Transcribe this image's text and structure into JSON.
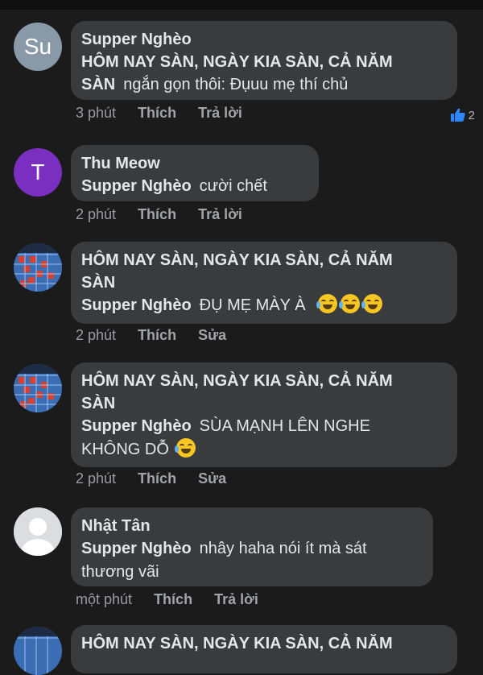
{
  "comments": [
    {
      "avatar_initials": "Su",
      "author": "Supper Nghèo",
      "text_line1": "HÔM NAY SÀN, NGÀY KIA SÀN, CẢ NĂM",
      "text_line2_bold": "SÀN",
      "text_line2_rest": "ngắn gọn thôi: Đụuu mẹ thí chủ",
      "time": "3 phút",
      "like": "Thích",
      "reply": "Trả lời",
      "reaction_count": "2"
    },
    {
      "avatar_initials": "T",
      "author": "Thu Meow",
      "mention": "Supper Nghèo",
      "text": "cười chết",
      "time": "2 phút",
      "like": "Thích",
      "reply": "Trả lời"
    },
    {
      "author_line1": "HÔM NAY SÀN, NGÀY KIA SÀN, CẢ NĂM",
      "author_line2": "SÀN",
      "mention": "Supper Nghèo",
      "text": "ĐỤ MẸ MÀY À",
      "time": "2 phút",
      "like": "Thích",
      "edit": "Sửa"
    },
    {
      "author_line1": "HÔM NAY SÀN, NGÀY KIA SÀN, CẢ NĂM",
      "author_line2": "SÀN",
      "mention": "Supper Nghèo",
      "text_line1": "SÙA MẠNH LÊN NGHE",
      "text_line2": "KHÔNG DỖ",
      "time": "2 phút",
      "like": "Thích",
      "edit": "Sửa"
    },
    {
      "author": "Nhật Tân",
      "mention": "Supper Nghèo",
      "text_line1": "nhây haha nói ít mà sát",
      "text_line2": "thương vãi",
      "time": "một phút",
      "like": "Thích",
      "reply": "Trả lời"
    },
    {
      "author_line1": "HÔM NAY SÀN, NGÀY KIA SÀN, CẢ NĂM"
    }
  ],
  "icons": {
    "like_reaction": "thumbs-up-icon",
    "laughing": "laughing-emoji-icon"
  },
  "colors": {
    "background": "#1b1b1c",
    "bubble": "#3a3b3c",
    "like_blue": "#2d88ff"
  }
}
